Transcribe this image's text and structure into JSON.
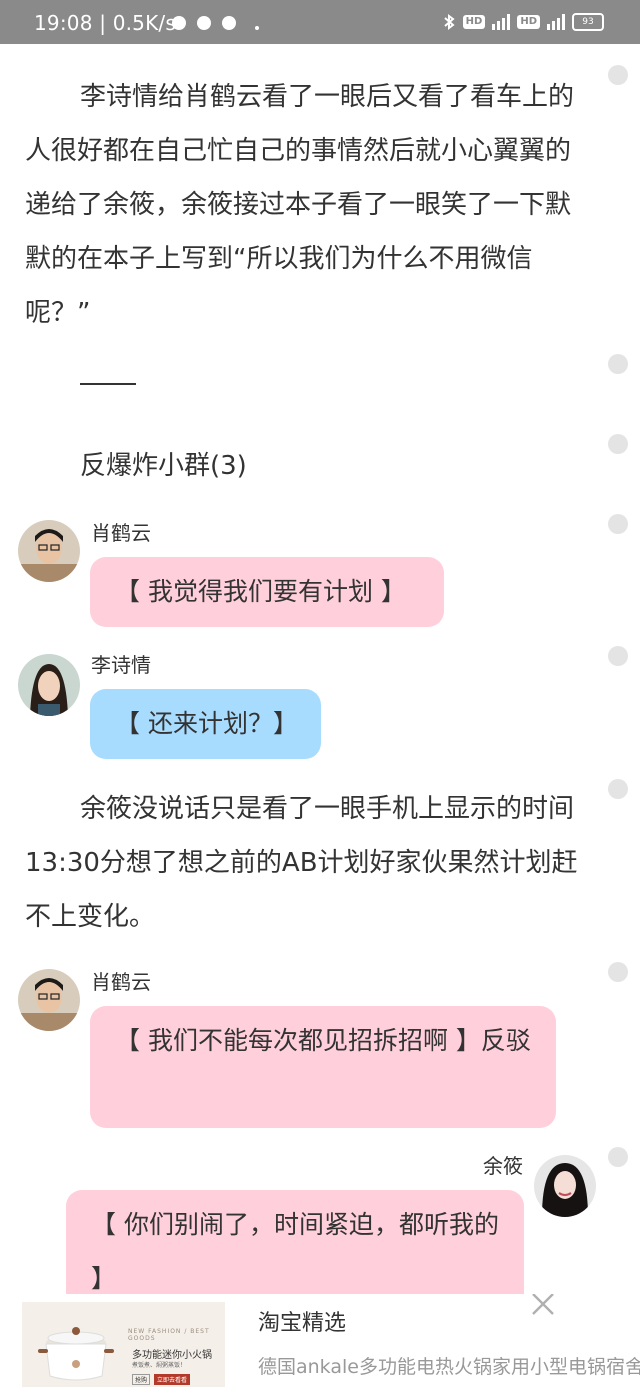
{
  "status_bar": {
    "text": "19:08 | 0.5K/s",
    "hd_1": "HD",
    "hd_2": "HD",
    "battery": "93"
  },
  "reader": {
    "paragraph_1": "李诗情给肖鹤云看了一眼后又看了看车上的人很好都在自己忙自己的事情然后就小心翼翼的递给了余筱，余筱接过本子看了一眼笑了一下默默的在本子上写到“所以我们为什么不用微信呢？”",
    "group_title": "反爆炸小群(3)",
    "paragraph_2": "余筱没说话只是看了一眼手机上显示的时间13:30分想了想之前的AB计划好家伙果然计划赶不上变化。"
  },
  "chat": [
    {
      "sender": "肖鹤云",
      "text": "【 我觉得我们要有计划 】",
      "side": "left",
      "color": "#ffd0dc"
    },
    {
      "sender": "李诗情",
      "text": "【 还来计划？】",
      "side": "left",
      "color": "#a8dcff"
    },
    {
      "sender": "肖鹤云",
      "text": "【 我们不能每次都见招拆招啊 】反驳",
      "side": "left",
      "color": "#ffd0dc"
    },
    {
      "sender": "余筱",
      "text": "【 你们别闹了，时间紧迫，都听我的 】",
      "side": "right",
      "color": "#ffd0dc"
    }
  ],
  "ad": {
    "title": "淘宝精选",
    "description": "德国ankale多功能电热火锅家用小型电锅宿舍学生",
    "image_brand": "NEW FASHION / BEST GOODS",
    "image_headline": "多功能迷你小火锅",
    "image_subline": "煮饭煮、焖粥蒸饭！",
    "image_button_1": "抢购",
    "image_button_2": "立即去看看"
  },
  "colors": {
    "status_bar": "#8a8a8a",
    "bubble_pink": "#ffd0dc",
    "bubble_blue": "#a8dcff",
    "text": "#333333",
    "muted": "#999999"
  },
  "icons": [
    "sync-icon",
    "minus-circle-icon",
    "clock-icon",
    "bluetooth-icon",
    "signal-icon",
    "battery-icon",
    "close-icon"
  ]
}
